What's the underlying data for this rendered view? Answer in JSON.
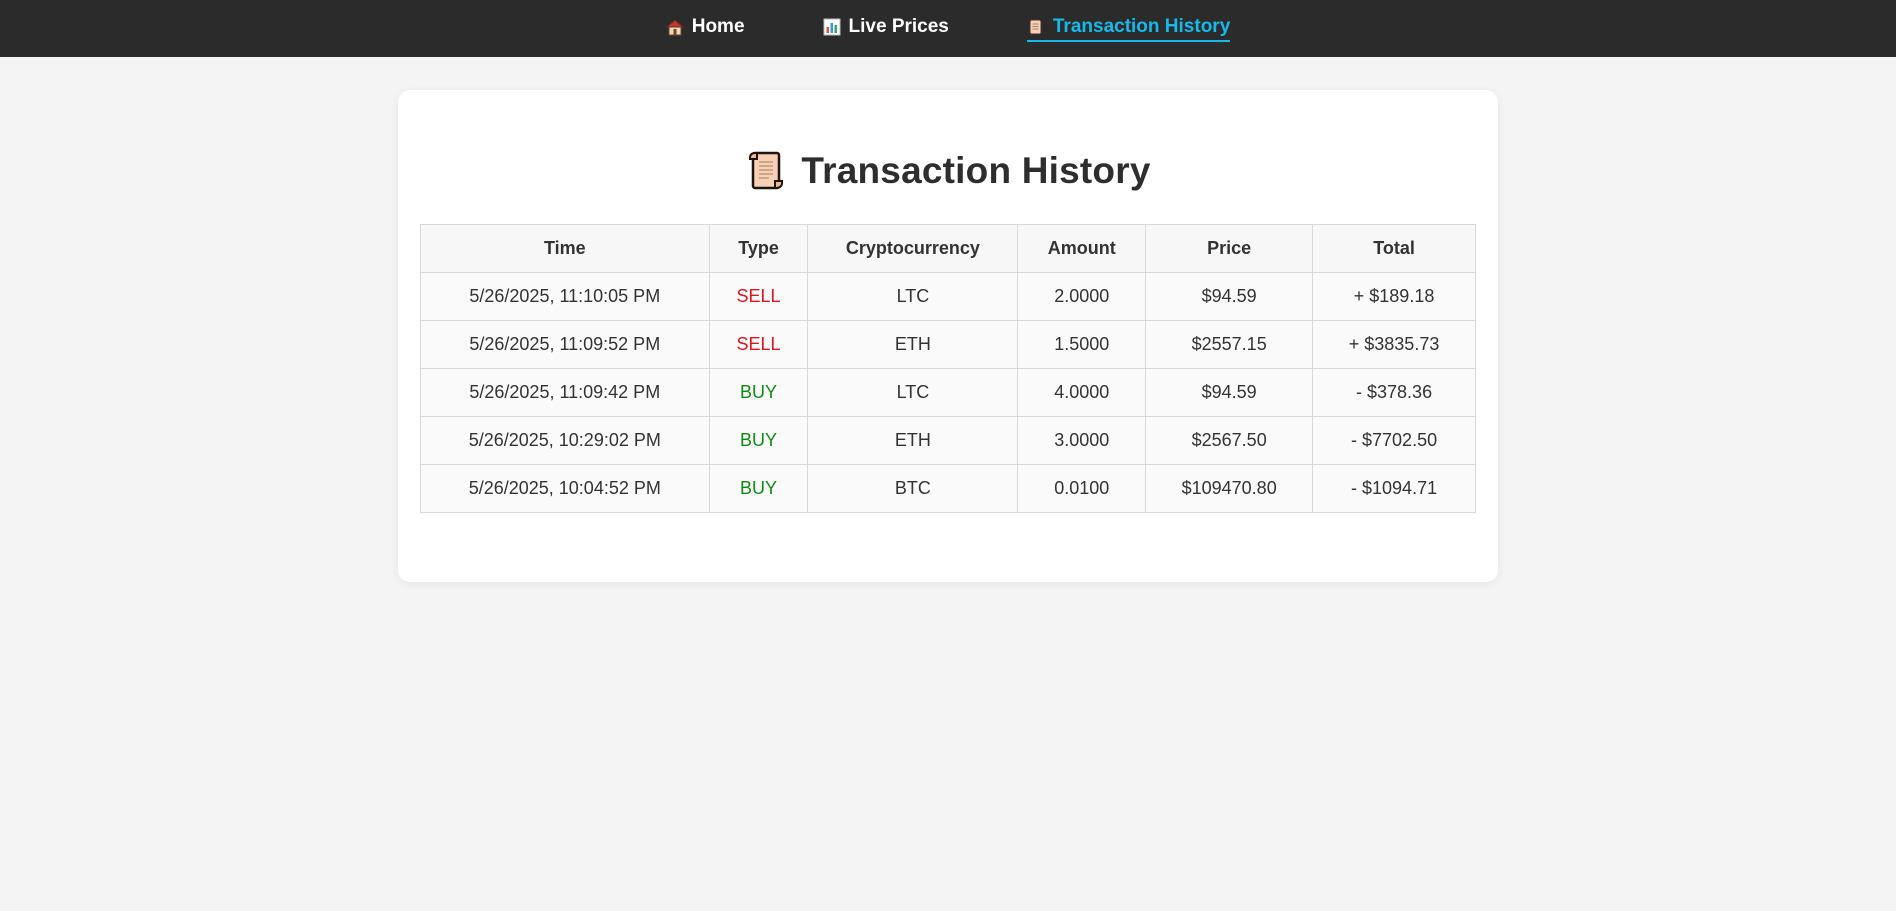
{
  "nav": {
    "items": [
      {
        "label": "Home",
        "icon": "house-icon",
        "active": false
      },
      {
        "label": "Live Prices",
        "icon": "bar-chart-icon",
        "active": false
      },
      {
        "label": "Transaction History",
        "icon": "scroll-icon",
        "active": true
      }
    ],
    "accent_color": "#17b9ea"
  },
  "page": {
    "title": "Transaction History",
    "title_icon": "scroll-icon"
  },
  "table": {
    "headers": [
      "Time",
      "Type",
      "Cryptocurrency",
      "Amount",
      "Price",
      "Total"
    ],
    "rows": [
      {
        "time": "5/26/2025, 11:10:05 PM",
        "type": "SELL",
        "crypto": "LTC",
        "amount": "2.0000",
        "price": "$94.59",
        "total": "+ $189.18"
      },
      {
        "time": "5/26/2025, 11:09:52 PM",
        "type": "SELL",
        "crypto": "ETH",
        "amount": "1.5000",
        "price": "$2557.15",
        "total": "+ $3835.73"
      },
      {
        "time": "5/26/2025, 11:09:42 PM",
        "type": "BUY",
        "crypto": "LTC",
        "amount": "4.0000",
        "price": "$94.59",
        "total": "- $378.36"
      },
      {
        "time": "5/26/2025, 10:29:02 PM",
        "type": "BUY",
        "crypto": "ETH",
        "amount": "3.0000",
        "price": "$2567.50",
        "total": "- $7702.50"
      },
      {
        "time": "5/26/2025, 10:04:52 PM",
        "type": "BUY",
        "crypto": "BTC",
        "amount": "0.0100",
        "price": "$109470.80",
        "total": "- $1094.71"
      }
    ]
  },
  "colors": {
    "sell": "#e0141e",
    "buy": "#118a11",
    "navbar_bg": "#2b2b2b",
    "page_bg": "#f4f4f4"
  }
}
